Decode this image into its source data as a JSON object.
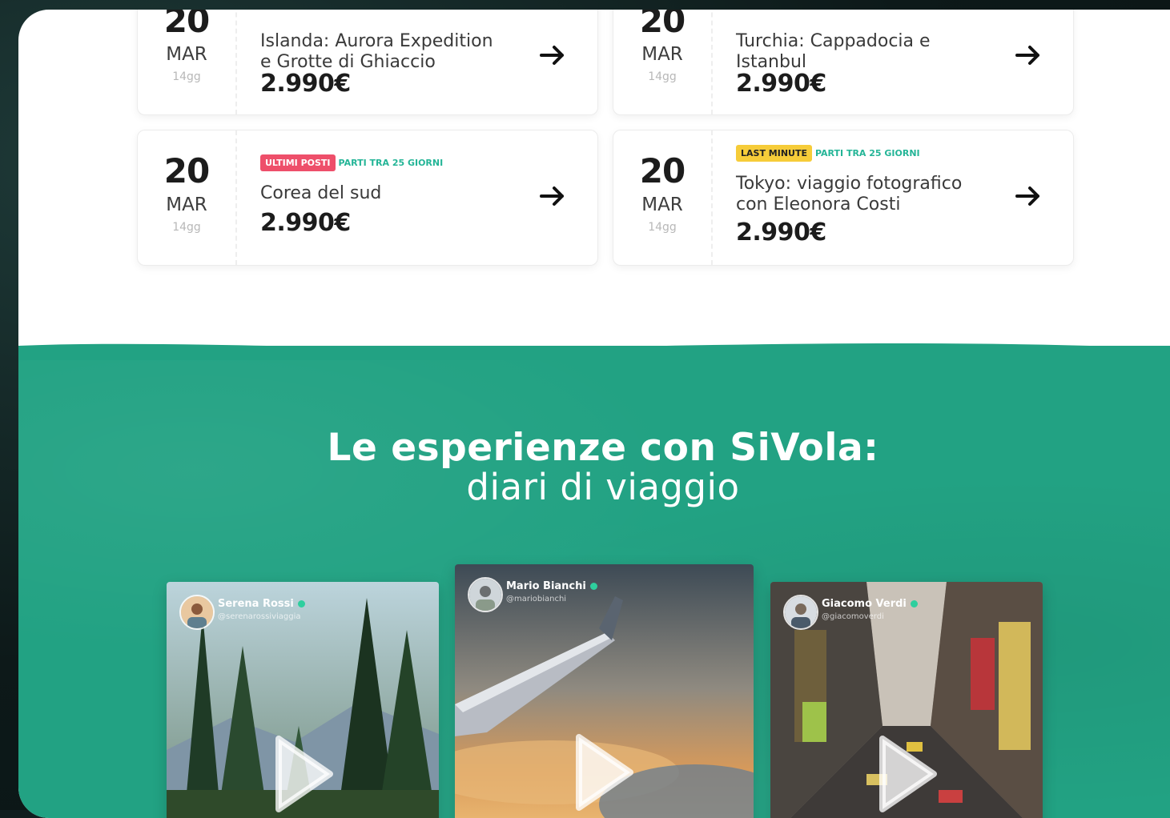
{
  "trips": [
    {
      "day": "20",
      "month": "MAR",
      "duration": "14gg",
      "badges": [
        {
          "text": "",
          "style": "red"
        }
      ],
      "title_line1": "Islanda: Aurora Expedition",
      "title_line2": "e Grotte di Ghiaccio",
      "price": "2.990€"
    },
    {
      "day": "20",
      "month": "MAR",
      "duration": "14gg",
      "badges": [
        {
          "text": "",
          "style": "yellow"
        }
      ],
      "title_line1": "Turchia: Cappadocia e",
      "title_line2": "Istanbul",
      "price": "2.990€"
    },
    {
      "day": "20",
      "month": "MAR",
      "duration": "14gg",
      "badges": [
        {
          "text": "ULTIMI POSTI",
          "style": "red"
        },
        {
          "text": "PARTI TRA 25 GIORNI",
          "style": "green"
        }
      ],
      "title_line1": "Corea del sud",
      "title_line2": "",
      "price": "2.990€"
    },
    {
      "day": "20",
      "month": "MAR",
      "duration": "14gg",
      "badges": [
        {
          "text": "LAST MINUTE",
          "style": "yellow"
        },
        {
          "text": "PARTI TRA 25 GIORNI",
          "style": "green"
        }
      ],
      "title_line1": "Tokyo: viaggio fotografico",
      "title_line2": "con Eleonora Costi",
      "price": "2.990€"
    }
  ],
  "experiences": {
    "title_bold": "Le esperienze con SiVola:",
    "title_light": "diari di viaggio",
    "videos": [
      {
        "author": "Serena Rossi",
        "handle": "@serenarossiviaggia",
        "scene": "forest"
      },
      {
        "author": "Mario Bianchi",
        "handle": "@mariobianchi",
        "scene": "airplane-wing"
      },
      {
        "author": "Giacomo Verdi",
        "handle": "@giacomoverdi",
        "scene": "city-street"
      }
    ]
  },
  "icons": {
    "arrow": "arrow-right-icon",
    "play": "play-icon",
    "verified": "verified-icon"
  },
  "colors": {
    "accent_green": "#22a283",
    "badge_red": "#ee4f6a",
    "badge_yellow": "#f6cc39",
    "badge_green_text": "#24b597"
  }
}
